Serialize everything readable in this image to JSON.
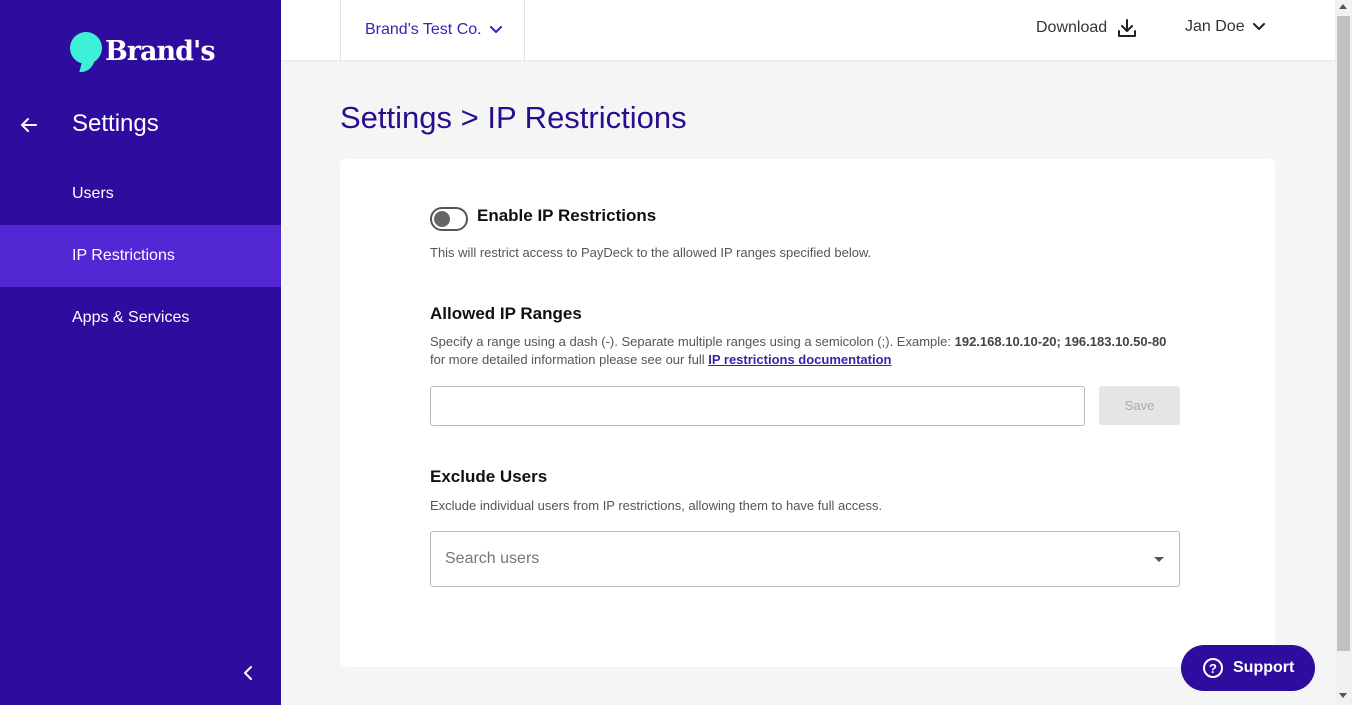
{
  "brand": {
    "name": "Brand's"
  },
  "sidebar": {
    "title": "Settings",
    "items": [
      {
        "label": "Users",
        "active": false
      },
      {
        "label": "IP Restrictions",
        "active": true
      },
      {
        "label": "Apps & Services",
        "active": false
      }
    ]
  },
  "header": {
    "company": "Brand's Test Co.",
    "download_label": "Download",
    "user_name": "Jan Doe"
  },
  "page": {
    "title": "Settings > IP Restrictions",
    "enable": {
      "label": "Enable IP Restrictions",
      "enabled": false,
      "description": "This will restrict access to PayDeck to the allowed IP ranges specified below."
    },
    "allowed_ranges": {
      "title": "Allowed IP Ranges",
      "help_prefix": "Specify a range using a dash (-). Separate multiple ranges using a semicolon (;). Example: ",
      "help_example": "192.168.10.10-20; 196.183.10.50-80",
      "help_line2": "for more detailed information please see our full ",
      "doc_link": "IP restrictions documentation",
      "input_value": "",
      "save_label": "Save"
    },
    "exclude_users": {
      "title": "Exclude Users",
      "description": "Exclude individual users from IP restrictions, allowing them to have full access.",
      "search_placeholder": "Search users"
    }
  },
  "support": {
    "label": "Support"
  },
  "colors": {
    "sidebar_bg": "#2e0d9e",
    "sidebar_active": "#5427d4",
    "accent": "#3ef0d6",
    "title": "#2a0c8c"
  }
}
